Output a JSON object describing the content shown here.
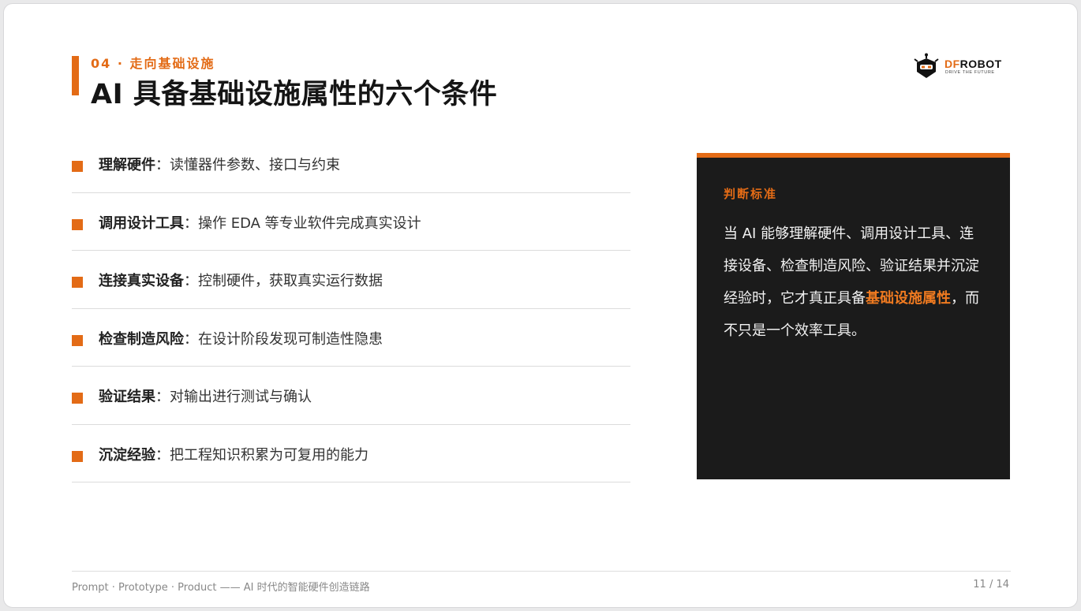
{
  "header": {
    "section_label": "04 · 走向基础设施",
    "title": "AI 具备基础设施属性的六个条件"
  },
  "logo": {
    "icon": "robot-head-icon",
    "wordmark_accent": "DF",
    "wordmark_rest": "ROBOT",
    "tagline": "DRIVE THE FUTURE"
  },
  "conditions": [
    {
      "name": "理解硬件",
      "separator": "：",
      "desc": "读懂器件参数、接口与约束"
    },
    {
      "name": "调用设计工具",
      "separator": "：",
      "desc": "操作 EDA 等专业软件完成真实设计"
    },
    {
      "name": "连接真实设备",
      "separator": "：",
      "desc": "控制硬件，获取真实运行数据"
    },
    {
      "name": "检查制造风险",
      "separator": "：",
      "desc": "在设计阶段发现可制造性隐患"
    },
    {
      "name": "验证结果",
      "separator": "：",
      "desc": "对输出进行测试与确认"
    },
    {
      "name": "沉淀经验",
      "separator": "：",
      "desc": "把工程知识积累为可复用的能力"
    }
  ],
  "panel": {
    "label": "判断标准",
    "text_before": "当 AI 能够理解硬件、调用设计工具、连接设备、检查制造风险、验证结果并沉淀经验时，它才真正具备",
    "text_highlight": "基础设施属性",
    "text_after": "，而不只是一个效率工具。"
  },
  "footer": {
    "left": "Prompt · Prototype · Product —— AI 时代的智能硬件创造链路",
    "page_indicator": "11 / 14"
  },
  "colors": {
    "accent": "#e36b16",
    "panel_bg": "#1b1b1b",
    "title": "#151515"
  }
}
